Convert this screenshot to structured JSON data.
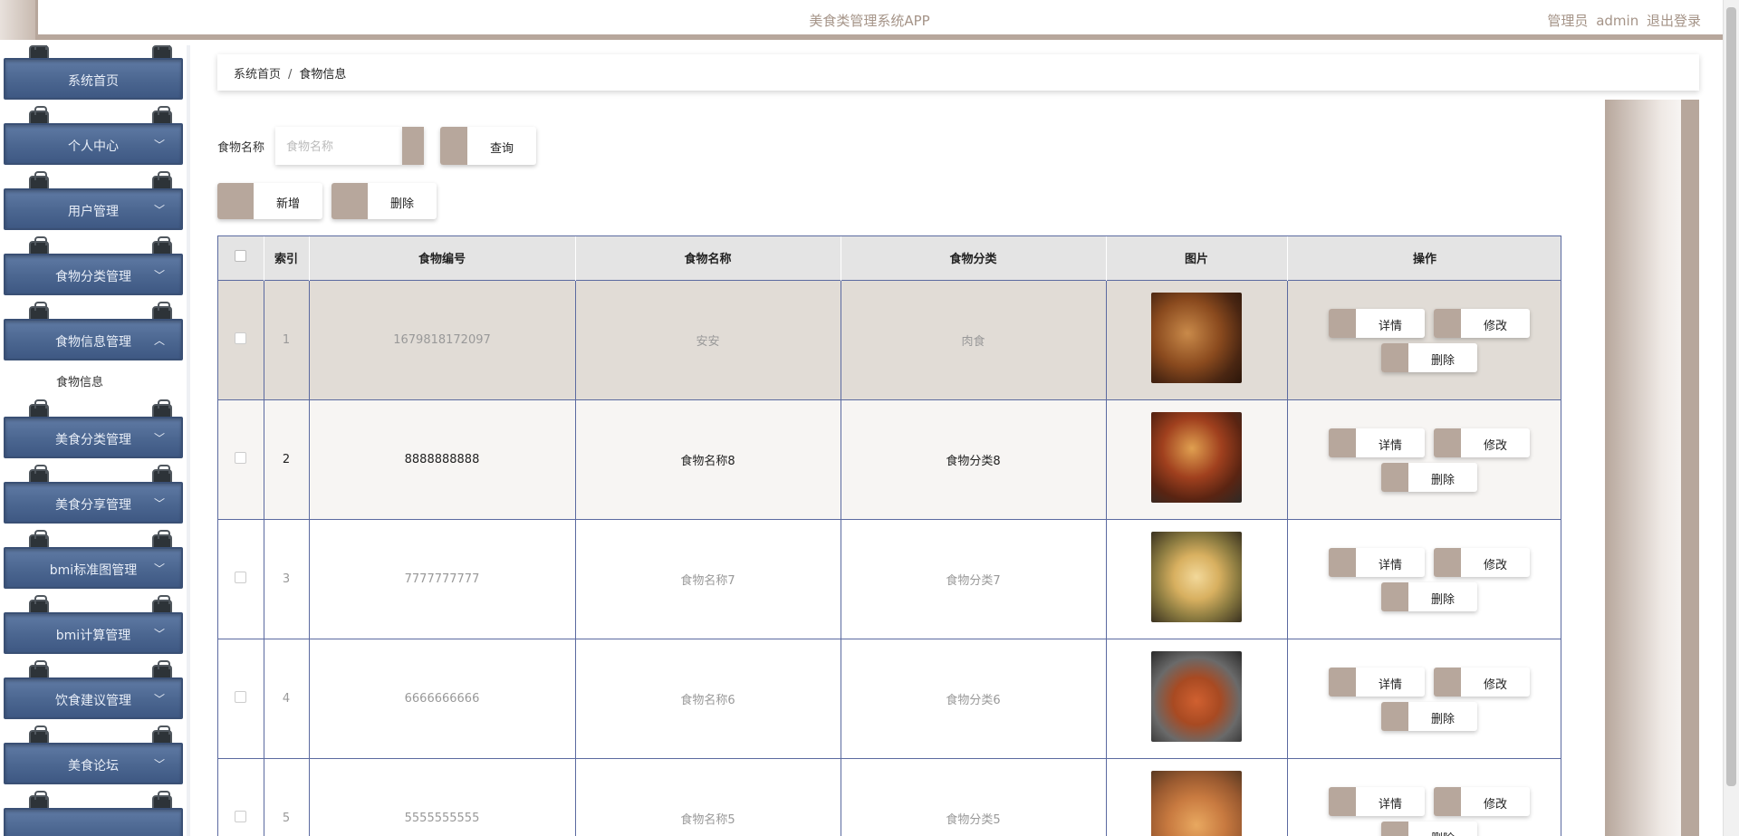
{
  "header": {
    "title": "美食类管理系统APP",
    "role": "管理员",
    "username": "admin",
    "logout": "退出登录"
  },
  "sidebar": {
    "items": [
      {
        "label": "系统首页",
        "chevron": ""
      },
      {
        "label": "个人中心",
        "chevron": "﹀"
      },
      {
        "label": "用户管理",
        "chevron": "﹀"
      },
      {
        "label": "食物分类管理",
        "chevron": "﹀"
      },
      {
        "label": "食物信息管理",
        "chevron": "︿"
      },
      {
        "label": "美食分类管理",
        "chevron": "﹀"
      },
      {
        "label": "美食分享管理",
        "chevron": "﹀"
      },
      {
        "label": "bmi标准图管理",
        "chevron": "﹀"
      },
      {
        "label": "bmi计算管理",
        "chevron": "﹀"
      },
      {
        "label": "饮食建议管理",
        "chevron": "﹀"
      },
      {
        "label": "美食论坛",
        "chevron": "﹀"
      }
    ],
    "submenu": "食物信息"
  },
  "breadcrumb": {
    "home": "系统首页",
    "separator": "/",
    "current": "食物信息"
  },
  "search": {
    "label": "食物名称",
    "placeholder": "食物名称",
    "button": "查询"
  },
  "actions": {
    "add": "新增",
    "delete": "删除"
  },
  "table": {
    "headers": [
      "",
      "索引",
      "食物编号",
      "食物名称",
      "食物分类",
      "图片",
      "操作"
    ],
    "rows": [
      {
        "index": "1",
        "code": "1679818172097",
        "name": "安安",
        "category": "肉食"
      },
      {
        "index": "2",
        "code": "8888888888",
        "name": "食物名称8",
        "category": "食物分类8"
      },
      {
        "index": "3",
        "code": "7777777777",
        "name": "食物名称7",
        "category": "食物分类7"
      },
      {
        "index": "4",
        "code": "6666666666",
        "name": "食物名称6",
        "category": "食物分类6"
      },
      {
        "index": "5",
        "code": "5555555555",
        "name": "食物名称5",
        "category": "食物分类5"
      }
    ],
    "ops": {
      "detail": "详情",
      "edit": "修改",
      "delete": "删除"
    }
  },
  "colors": {
    "accent": "#b7a79c",
    "menu": "#4b6690",
    "border": "#5b6aa0"
  }
}
